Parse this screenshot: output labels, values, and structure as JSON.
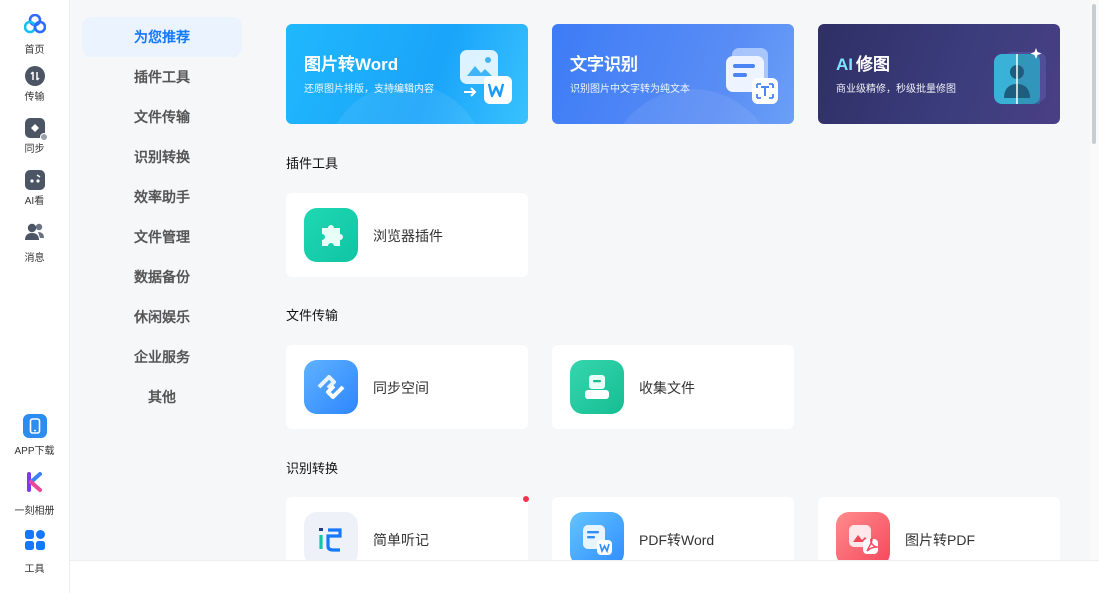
{
  "rail": {
    "items": [
      {
        "label": "首页",
        "icon": "cloud-logo-icon"
      },
      {
        "label": "传输",
        "icon": "transfer-icon"
      },
      {
        "label": "同步",
        "icon": "sync-icon"
      },
      {
        "label": "AI看",
        "icon": "ai-view-icon"
      },
      {
        "label": "消息",
        "icon": "message-icon"
      }
    ],
    "bottom_items": [
      {
        "label": "APP下载",
        "icon": "phone-icon"
      },
      {
        "label": "一刻相册",
        "icon": "album-icon"
      },
      {
        "label": "工具",
        "icon": "tools-grid-icon"
      }
    ]
  },
  "categories": [
    "为您推荐",
    "插件工具",
    "文件传输",
    "识别转换",
    "效率助手",
    "文件管理",
    "数据备份",
    "休闲娱乐",
    "企业服务",
    "其他"
  ],
  "active_category": "为您推荐",
  "banners": [
    {
      "title": "图片转Word",
      "subtitle": "还原图片排版，支持编辑内容"
    },
    {
      "title": "文字识别",
      "subtitle": "识别图片中文字转为纯文本"
    },
    {
      "title": "修图",
      "title_prefix": "AI",
      "subtitle": "商业级精修，秒级批量修图"
    }
  ],
  "sections": {
    "plugins": {
      "title": "插件工具",
      "cards": [
        {
          "label": "浏览器插件"
        }
      ]
    },
    "transfer": {
      "title": "文件传输",
      "cards": [
        {
          "label": "同步空间"
        },
        {
          "label": "收集文件"
        }
      ]
    },
    "convert": {
      "title": "识别转换",
      "cards": [
        {
          "label": "简单听记"
        },
        {
          "label": "PDF转Word"
        },
        {
          "label": "图片转PDF"
        }
      ]
    }
  },
  "colors": {
    "accent": "#1677ff",
    "badge": "#f5334f"
  }
}
